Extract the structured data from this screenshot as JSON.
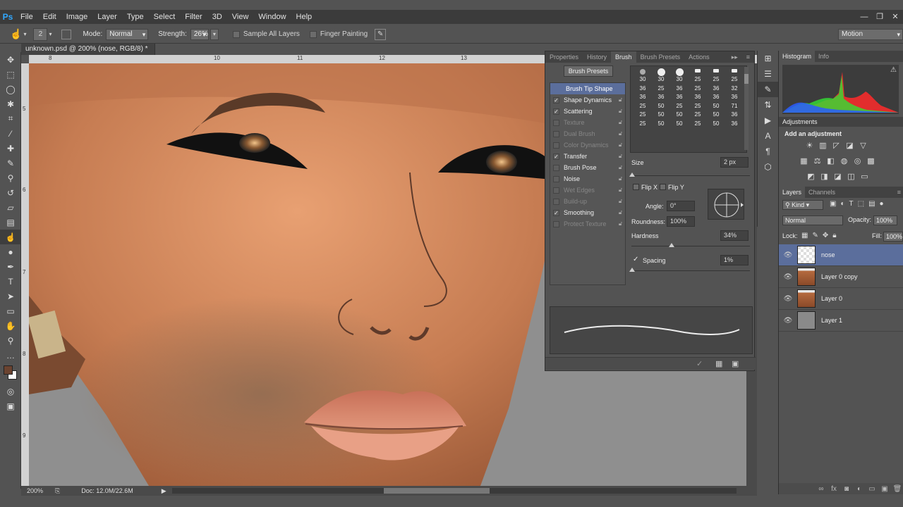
{
  "app": {
    "logo": "Ps",
    "window_controls": [
      "—",
      "❐",
      "✕"
    ]
  },
  "menubar": {
    "items": [
      "File",
      "Edit",
      "Image",
      "Layer",
      "Type",
      "Select",
      "Filter",
      "3D",
      "View",
      "Window",
      "Help"
    ]
  },
  "options": {
    "brush_size": "2",
    "mode_label": "Mode:",
    "mode_value": "Normal",
    "strength_label": "Strength:",
    "strength_value": "26%",
    "sample_all_layers": "Sample All Layers",
    "finger_painting": "Finger Painting",
    "workspace": "Motion"
  },
  "document": {
    "tab_title": "unknown.psd @ 200% (nose, RGB/8) *",
    "ruler_h": [
      "8",
      "10",
      "11",
      "12",
      "13"
    ],
    "ruler_v": [
      "5",
      "6",
      "7",
      "8",
      "9"
    ],
    "zoom": "200%",
    "doc_info": "Doc: 12.0M/22.6M"
  },
  "brush_panel": {
    "tabs": [
      "Properties",
      "History",
      "Brush",
      "Brush Presets",
      "Actions"
    ],
    "presets_button": "Brush Presets",
    "items": [
      {
        "label": "Brush Tip Shape",
        "checked": false,
        "state": "selected"
      },
      {
        "label": "Shape Dynamics",
        "checked": true,
        "state": "on"
      },
      {
        "label": "Scattering",
        "checked": true,
        "state": "on"
      },
      {
        "label": "Texture",
        "checked": false,
        "state": "disabled"
      },
      {
        "label": "Dual Brush",
        "checked": false,
        "state": "disabled"
      },
      {
        "label": "Color Dynamics",
        "checked": false,
        "state": "disabled"
      },
      {
        "label": "Transfer",
        "checked": true,
        "state": "on"
      },
      {
        "label": "Brush Pose",
        "checked": false,
        "state": "on"
      },
      {
        "label": "Noise",
        "checked": false,
        "state": "on"
      },
      {
        "label": "Wet Edges",
        "checked": false,
        "state": "disabled"
      },
      {
        "label": "Build-up",
        "checked": false,
        "state": "disabled"
      },
      {
        "label": "Smoothing",
        "checked": true,
        "state": "on"
      },
      {
        "label": "Protect Texture",
        "checked": false,
        "state": "disabled"
      }
    ],
    "tip_sizes": [
      "30",
      "30",
      "30",
      "25",
      "25",
      "25",
      "36",
      "25",
      "36",
      "25",
      "36",
      "32",
      "36",
      "36",
      "36",
      "36",
      "36",
      "36",
      "25",
      "50",
      "25",
      "25",
      "50",
      "71",
      "25",
      "50",
      "50",
      "25",
      "50",
      "36",
      "25",
      "50",
      "50",
      "25",
      "50",
      "36"
    ],
    "size_label": "Size",
    "size_value": "2 px",
    "flip_x": "Flip X",
    "flip_y": "Flip Y",
    "angle_label": "Angle:",
    "angle_value": "0°",
    "roundness_label": "Roundness:",
    "roundness_value": "100%",
    "hardness_label": "Hardness",
    "hardness_value": "34%",
    "spacing_label": "Spacing",
    "spacing_value": "1%"
  },
  "right_panels": {
    "histogram_tabs": [
      "Histogram",
      "Info"
    ],
    "adjustments_title": "Adjustments",
    "add_adjustment": "Add an adjustment",
    "layers_tabs": [
      "Layers",
      "Channels"
    ],
    "kind_label": "Kind",
    "blend_mode": "Normal",
    "opacity_label": "Opacity:",
    "opacity_value": "100%",
    "lock_label": "Lock:",
    "fill_label": "Fill:",
    "fill_value": "100%",
    "layers": [
      {
        "name": "nose",
        "selected": true,
        "thumb": "transparent"
      },
      {
        "name": "Layer 0 copy",
        "selected": false,
        "thumb": "photo"
      },
      {
        "name": "Layer 0",
        "selected": false,
        "thumb": "photo"
      },
      {
        "name": "Layer 1",
        "selected": false,
        "thumb": "gray"
      }
    ]
  }
}
